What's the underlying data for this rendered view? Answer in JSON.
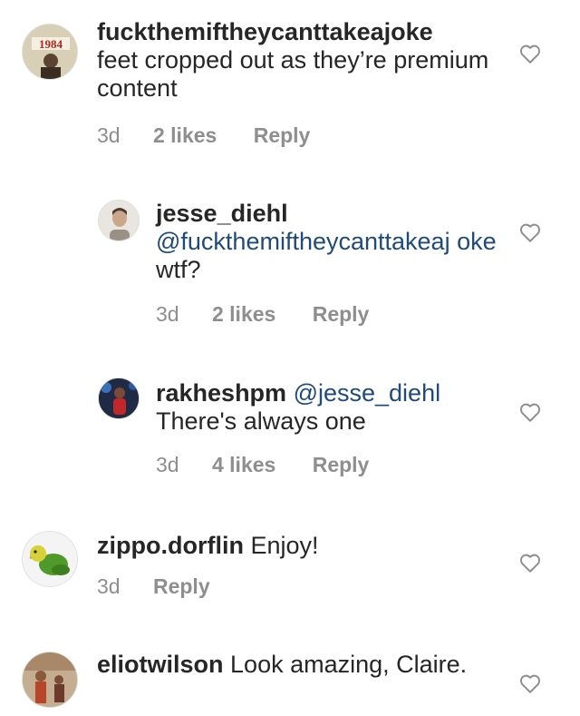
{
  "comments": [
    {
      "username": "fuckthemiftheycanttakeajoke",
      "text": "feet cropped out as they’re premium content",
      "time": "3d",
      "likes": "2 likes",
      "reply": "Reply",
      "avatar_text": "1984"
    },
    {
      "username": "jesse_diehl",
      "mention": "@fuckthemiftheycanttakeaj oke",
      "text": "wtf?",
      "time": "3d",
      "likes": "2 likes",
      "reply": "Reply"
    },
    {
      "username": "rakheshpm",
      "mention": "@jesse_diehl",
      "text": "There's always one",
      "time": "3d",
      "likes": "4 likes",
      "reply": "Reply"
    },
    {
      "username": "zippo.dorflin",
      "text": "Enjoy!",
      "time": "3d",
      "reply": "Reply"
    },
    {
      "username": "eliotwilson",
      "text": "Look amazing, Claire."
    }
  ],
  "colors": {
    "text": "#262626",
    "meta": "#8e8e8e",
    "mention": "#1f4a7a"
  }
}
